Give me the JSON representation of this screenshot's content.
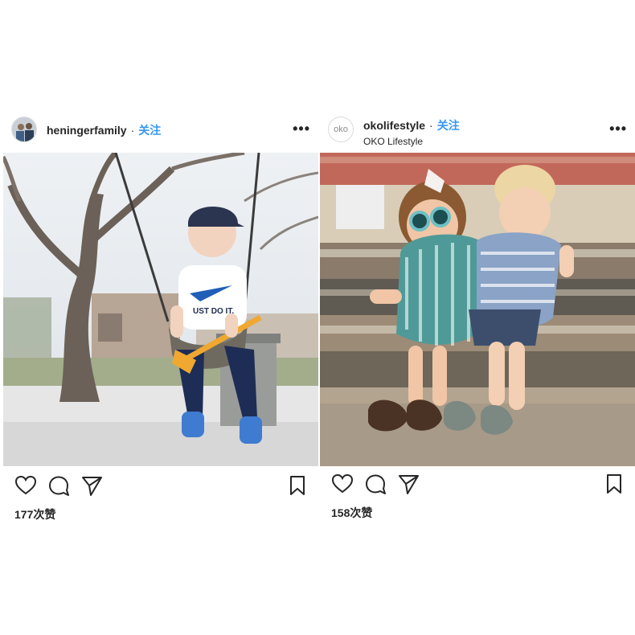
{
  "posts": [
    {
      "username": "heningerfamily",
      "follow_label": "关注",
      "separator": "·",
      "more_label": "•••",
      "likes": "177次赞",
      "photo_icon": "swing-photo"
    },
    {
      "username": "okolifestyle",
      "avatar_text": "oko",
      "subname": "OKO Lifestyle",
      "follow_label": "关注",
      "separator": "·",
      "more_label": "•••",
      "likes": "158次赞",
      "photo_icon": "kids-on-bench-photo"
    }
  ],
  "icons": [
    "heart-icon",
    "comment-icon",
    "share-icon",
    "bookmark-icon"
  ],
  "colors": {
    "follow": "#3897f0",
    "text": "#262626"
  }
}
